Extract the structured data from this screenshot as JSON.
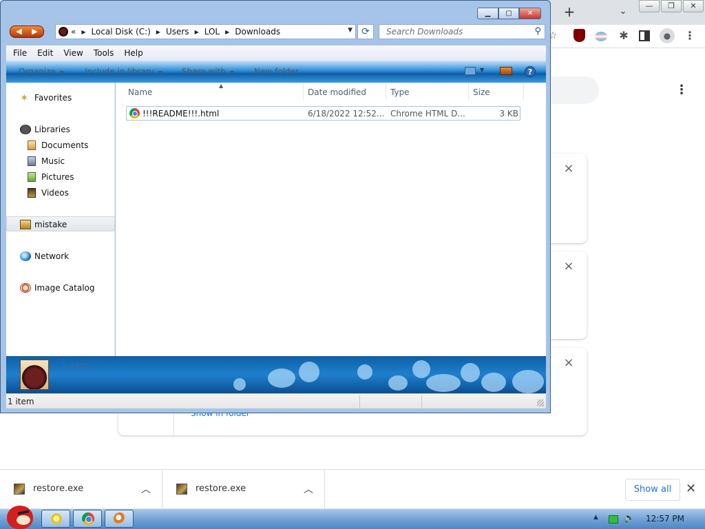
{
  "explorer": {
    "address": {
      "crumbs": [
        "«",
        "Local Disk (C:)",
        "Users",
        "LOL",
        "Downloads"
      ]
    },
    "search_placeholder": "Search Downloads",
    "menu": [
      "File",
      "Edit",
      "View",
      "Tools",
      "Help"
    ],
    "commands": [
      "Organize",
      "Include in library",
      "Share with",
      "New folder"
    ],
    "nav": {
      "favorites": "Favorites",
      "libraries": "Libraries",
      "documents": "Documents",
      "music": "Music",
      "pictures": "Pictures",
      "videos": "Videos",
      "computer": "mistake",
      "network": "Network",
      "image_catalog": "Image Catalog"
    },
    "columns": [
      "Name",
      "Date modified",
      "Type",
      "Size"
    ],
    "files": [
      {
        "name": "!!!README!!!.html",
        "date": "6/18/2022 12:52...",
        "type": "Chrome HTML D...",
        "size": "3 KB"
      }
    ],
    "details_count": "1 item",
    "status": "1 item"
  },
  "chrome": {
    "show_in_folder": "Show in folder",
    "shelf": {
      "items": [
        {
          "name": "restore.exe"
        },
        {
          "name": "restore.exe"
        }
      ],
      "show_all": "Show all"
    }
  },
  "taskbar": {
    "clock": "12:57 PM"
  }
}
